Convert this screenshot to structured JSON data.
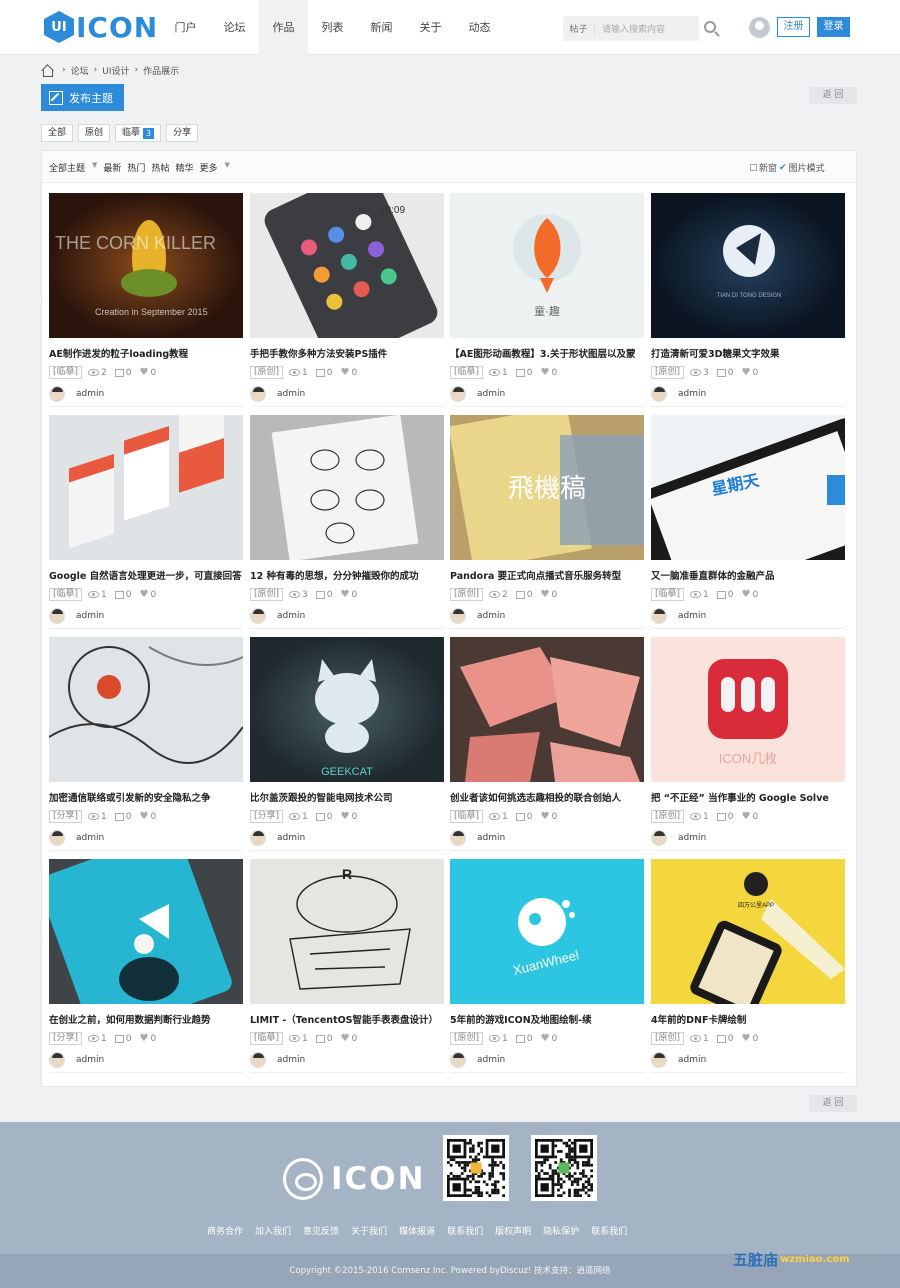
{
  "header": {
    "logo_badge": "UI",
    "logo_text": "ICON",
    "nav": [
      "门户",
      "论坛",
      "作品",
      "列表",
      "新闻",
      "关于",
      "动态"
    ],
    "active_nav": 2,
    "search_type": "帖子",
    "search_placeholder": "请输入搜索内容",
    "register_label": "注册",
    "login_label": "登录"
  },
  "breadcrumb": [
    "论坛",
    "UI设计",
    "作品展示"
  ],
  "publish_label": "发布主题",
  "back_label": "返 回",
  "filters": {
    "all": "全部",
    "original": "原创",
    "copy": "临摹",
    "copy_count": "3",
    "share": "分享"
  },
  "sort_bar": {
    "all_topics": "全部主题",
    "latest": "最新",
    "hot": "热门",
    "hot_posts": "热帖",
    "digest": "精华",
    "more": "更多",
    "new_window": "新窗",
    "image_mode": "图片模式"
  },
  "cards": [
    {
      "title": "AE制作进发的粒子loading教程",
      "tag": "[临摹]",
      "views": "2",
      "comments": "0",
      "likes": "0",
      "author": "admin",
      "thumb_text": "THE CORN KILLER"
    },
    {
      "title": "手把手教你多种方法安装PS插件",
      "tag": "[原创]",
      "views": "1",
      "comments": "0",
      "likes": "0",
      "author": "admin",
      "thumb_text": "10:09"
    },
    {
      "title": "【AE图形动画教程】3.关于形状图层以及蒙",
      "tag": "[临摹]",
      "views": "1",
      "comments": "0",
      "likes": "0",
      "author": "admin",
      "thumb_text": "童·趣"
    },
    {
      "title": "打造清新可爱3D糖果文字效果",
      "tag": "[原创]",
      "views": "3",
      "comments": "0",
      "likes": "0",
      "author": "admin",
      "thumb_text": "TIAN DI TONG DESIGN"
    },
    {
      "title": "Google 自然语言处理更进一步，可直接回答",
      "tag": "[临摹]",
      "views": "1",
      "comments": "0",
      "likes": "0",
      "author": "admin",
      "thumb_text": ""
    },
    {
      "title": "12 种有毒的思想，分分钟摧毁你的成功",
      "tag": "[原创]",
      "views": "3",
      "comments": "0",
      "likes": "0",
      "author": "admin",
      "thumb_text": ""
    },
    {
      "title": "Pandora 要正式向点播式音乐服务转型",
      "tag": "[原创]",
      "views": "2",
      "comments": "0",
      "likes": "0",
      "author": "admin",
      "thumb_text": "飛機稿"
    },
    {
      "title": "又一脑准垂直群体的金融产品",
      "tag": "[临摹]",
      "views": "1",
      "comments": "0",
      "likes": "0",
      "author": "admin",
      "thumb_text": "星期天"
    },
    {
      "title": "加密通信联络或引发新的安全隐私之争",
      "tag": "[分享]",
      "views": "1",
      "comments": "0",
      "likes": "0",
      "author": "admin",
      "thumb_text": ""
    },
    {
      "title": "比尔盖茨跟投的智能电网技术公司",
      "tag": "[分享]",
      "views": "1",
      "comments": "0",
      "likes": "0",
      "author": "admin",
      "thumb_text": "GEEKCAT"
    },
    {
      "title": "创业者该如何挑选志趣相投的联合创始人",
      "tag": "[临摹]",
      "views": "1",
      "comments": "0",
      "likes": "0",
      "author": "admin",
      "thumb_text": ""
    },
    {
      "title": "把 “不正经” 当作事业的 Google Solve",
      "tag": "[原创]",
      "views": "1",
      "comments": "0",
      "likes": "0",
      "author": "admin",
      "thumb_text": "ICON几枚"
    },
    {
      "title": "在创业之前，如何用数据判断行业趋势",
      "tag": "[分享]",
      "views": "1",
      "comments": "0",
      "likes": "0",
      "author": "admin",
      "thumb_text": ""
    },
    {
      "title": "LIMIT -（TencentOS智能手表表盘设计）",
      "tag": "[临摹]",
      "views": "1",
      "comments": "0",
      "likes": "0",
      "author": "admin",
      "thumb_text": ""
    },
    {
      "title": "5年前的游戏ICON及地图绘制-续",
      "tag": "[原创]",
      "views": "1",
      "comments": "0",
      "likes": "0",
      "author": "admin",
      "thumb_text": "XuanWheel"
    },
    {
      "title": "4年前的DNF卡牌绘制",
      "tag": "[原创]",
      "views": "1",
      "comments": "0",
      "likes": "0",
      "author": "admin",
      "thumb_text": "四万公里APP"
    }
  ],
  "footer": {
    "logo_text": "ICON",
    "links": [
      "商务合作",
      "加入我们",
      "意见反馈",
      "关于我们",
      "媒体报道",
      "联系我们",
      "版权声明",
      "隐私保护",
      "联系我们"
    ],
    "copyright": "Copyright  ©2015-2016  Comsenz Inc.  Powered byDiscuz!  技术支持：逍遥网络"
  },
  "watermark": {
    "text": "五脏庙",
    "sub": "wzmiao.com"
  }
}
